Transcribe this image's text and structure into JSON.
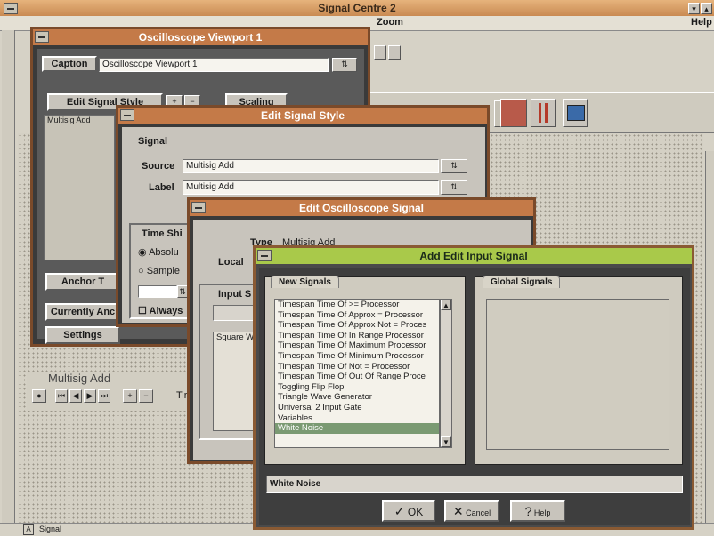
{
  "main": {
    "title": "Signal Centre 2",
    "menu": {
      "zoom": "Zoom",
      "help": "Help"
    },
    "status": "Signal"
  },
  "oscilloscope_viewport": {
    "title": "Oscilloscope Viewport 1",
    "caption_label": "Caption",
    "caption_value": "Oscilloscope Viewport 1",
    "tab_edit": "Edit Signal Style",
    "tab_scaling": "Scaling",
    "list_item": "Multisig Add",
    "anchor_btn": "Anchor T",
    "currently_btn": "Currently Anc",
    "settings_btn": "Settings"
  },
  "mini_trace": {
    "label": "Multisig Add",
    "tip": "Tir"
  },
  "edit_signal_style": {
    "title": "Edit Signal Style",
    "group": "Signal",
    "source_label": "Source",
    "source_value": "Multisig Add",
    "label_label": "Label",
    "label_value": "Multisig Add",
    "time_group": "Time Shi",
    "radio1": "Absolu",
    "radio2": "Sample",
    "check": "Always"
  },
  "edit_oscilloscope_signal": {
    "title": "Edit Oscilloscope Signal",
    "type_label": "Type",
    "type_value": "Multisig Add",
    "local_label": "Local",
    "input_group": "Input S",
    "input_item": "Square W"
  },
  "add_edit_input": {
    "title": "Add Edit Input Signal",
    "new_signals_tab": "New Signals",
    "global_signals_tab": "Global Signals",
    "new_signals": [
      "Timespan Time Of >= Processor",
      "Timespan Time Of Approx = Processor",
      "Timespan Time Of Approx Not = Proces",
      "Timespan Time Of In Range Processor",
      "Timespan Time Of Maximum Processor",
      "Timespan Time Of Minimum Processor",
      "Timespan Time Of Not = Processor",
      "Timespan Time Of Out Of Range Proce",
      "Toggling Flip Flop",
      "Triangle Wave Generator",
      "Universal 2 Input Gate",
      "Variables",
      "White Noise"
    ],
    "selected_value": "White Noise",
    "ok": "OK",
    "cancel": "Cancel",
    "help": "Help"
  },
  "colors": {
    "main_title": "#d9a46a",
    "active_title": "#a9c94a",
    "inactive_title": "#c47a48",
    "frame": "#8b5a33"
  }
}
